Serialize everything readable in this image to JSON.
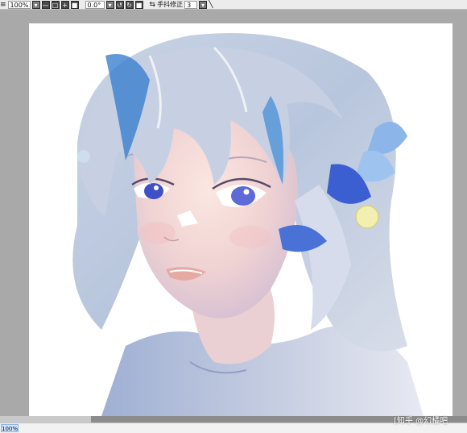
{
  "toolbar": {
    "menu_glyph": "≡",
    "zoom_value": "100%",
    "zoom_out_label": "—",
    "zoom_reset_label": "□",
    "zoom_in_label": "+",
    "fit_label": "■",
    "rotation_value": "0.0°",
    "rotate_left_label": "↺",
    "rotate_right_label": "↻",
    "rotate_reset_label": "■",
    "stabilizer_icon": "⇆",
    "stabilizer_label": "手抖修正",
    "stabilizer_value": "3",
    "pen_tool_icon": "╲"
  },
  "status": {
    "zoom": "100%"
  },
  "watermark": "[知乎 @幻橘吧"
}
